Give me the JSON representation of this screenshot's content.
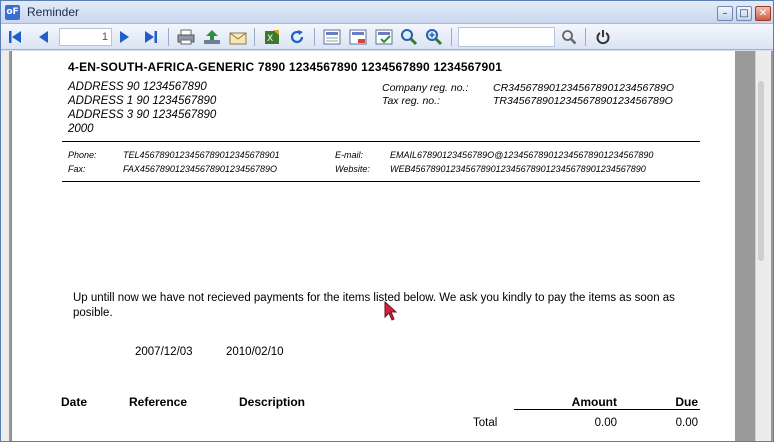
{
  "window": {
    "title": "Reminder",
    "app_icon_text": "oF"
  },
  "toolbar": {
    "page_number": "1",
    "search_value": "",
    "icons": [
      "first-page-icon",
      "prev-page-icon",
      "next-page-icon",
      "last-page-icon",
      "print-icon",
      "export-icon",
      "email-icon",
      "excel-icon",
      "refresh-icon",
      "layout-icon",
      "layout-red-icon",
      "checklist-icon",
      "zoom-icon",
      "zoom-in-icon",
      "search-icon",
      "power-icon"
    ]
  },
  "document": {
    "company_name": "4-EN-SOUTH-AFRICA-GENERIC 7890 1234567890 1234567890 1234567901",
    "address": [
      "ADDRESS 90 1234567890",
      "ADDRESS 1 90 1234567890",
      "ADDRESS 3 90 1234567890",
      "2000"
    ],
    "company_reg_label": "Company reg. no.:",
    "company_reg_value": "CR345678901234567890123456789O",
    "tax_reg_label": "Tax reg. no.:",
    "tax_reg_value": "TR345678901234567890123456789O",
    "phone_label": "Phone:",
    "phone_value": "TEL4567890123456789012345678901",
    "fax_label": "Fax:",
    "fax_value": "FAX45678901234567890123456789O",
    "email_label": "E-mail:",
    "email_value": "EMAIL67890123456789O@123456789012345678901234567890",
    "website_label": "Website:",
    "website_value": "WEB45678901234567890123456789012345678901234567890",
    "message": "Up untill now we have not recieved payments for the items listed below. We ask you kindly to pay the items as soon as posible.",
    "date_1": "2007/12/03",
    "date_2": "2010/02/10",
    "columns": {
      "date": "Date",
      "reference": "Reference",
      "description": "Description",
      "amount": "Amount",
      "due": "Due"
    },
    "total_label": "Total",
    "total_amount": "0.00",
    "total_due": "0.00"
  }
}
